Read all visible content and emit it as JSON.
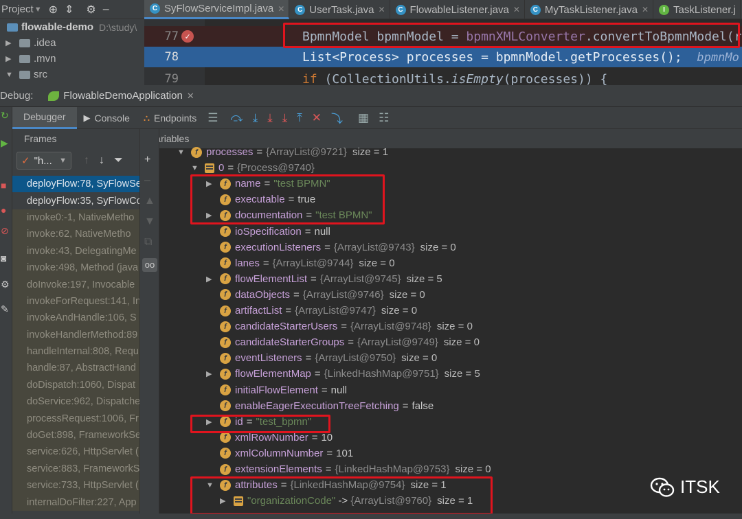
{
  "project": {
    "title": "Project",
    "tree": [
      {
        "name": "flowable-demo",
        "path": "D:\\study\\"
      },
      {
        "name": ".idea"
      },
      {
        "name": ".mvn"
      },
      {
        "name": "src"
      }
    ]
  },
  "editor": {
    "tabs": [
      {
        "label": "SyFlowServiceImpl.java",
        "active": true
      },
      {
        "label": "UserTask.java",
        "active": false
      },
      {
        "label": "FlowableListener.java",
        "active": false
      },
      {
        "label": "MyTaskListener.java",
        "active": false
      },
      {
        "label": "TaskListener.j",
        "active": false
      }
    ],
    "lines": {
      "l77": {
        "num": "77",
        "t1": "BpmnModel bpmnModel = ",
        "t2": "bpmnXMLConverter",
        "t3": ".",
        "t4": "convertToBpmnModel",
        "t5": "(r"
      },
      "l78": {
        "num": "78",
        "t1": "List<Process> processes = bpmnModel.",
        "t2": "getProcesses",
        "t3": "();",
        "hint": "bpmnMo"
      },
      "l79": {
        "num": "79",
        "t1": "if",
        "t2": " (CollectionUtils.",
        "t3": "isEmpty",
        "t4": "(processes)) {"
      }
    }
  },
  "debug": {
    "label": "Debug:",
    "config": "FlowableDemoApplication",
    "tabs": {
      "debugger": "Debugger",
      "console": "Console",
      "endpoints": "Endpoints"
    },
    "frames_title": "Frames",
    "thread_filter": "\"h...",
    "variables_title": "Variables"
  },
  "frames": [
    {
      "text": "deployFlow:78, SyFlowSe",
      "style": "sel"
    },
    {
      "text": "deployFlow:35, SyFlowCo",
      "style": "bright"
    },
    {
      "text": "invoke0:-1, NativeMetho",
      "style": "lib"
    },
    {
      "text": "invoke:62, NativeMetho",
      "style": "lib"
    },
    {
      "text": "invoke:43, DelegatingMe",
      "style": "lib"
    },
    {
      "text": "invoke:498, Method (java",
      "style": "lib"
    },
    {
      "text": "doInvoke:197, Invocable",
      "style": "lib"
    },
    {
      "text": "invokeForRequest:141, In",
      "style": "lib"
    },
    {
      "text": "invokeAndHandle:106, S",
      "style": "lib"
    },
    {
      "text": "invokeHandlerMethod:89",
      "style": "lib"
    },
    {
      "text": "handleInternal:808, Requ",
      "style": "lib"
    },
    {
      "text": "handle:87, AbstractHand",
      "style": "lib"
    },
    {
      "text": "doDispatch:1060, Dispat",
      "style": "lib"
    },
    {
      "text": "doService:962, Dispatche",
      "style": "lib"
    },
    {
      "text": "processRequest:1006, Fr",
      "style": "lib"
    },
    {
      "text": "doGet:898, FrameworkSe",
      "style": "lib"
    },
    {
      "text": "service:626, HttpServlet (",
      "style": "lib"
    },
    {
      "text": "service:883, FrameworkS",
      "style": "lib"
    },
    {
      "text": "service:733, HttpServlet (",
      "style": "lib"
    },
    {
      "text": "internalDoFilter:227, App",
      "style": "lib"
    }
  ],
  "variables": [
    {
      "indent": 0,
      "tri": "▼",
      "icon": "f",
      "name": "processes",
      "ref": "{ArrayList@9721}",
      "size": "size = 1"
    },
    {
      "indent": 1,
      "tri": "▼",
      "icon": "list",
      "name": "0",
      "ref": "{Process@9740}"
    },
    {
      "indent": 2,
      "tri": "▶",
      "icon": "f",
      "name": "name",
      "str": "\"test BPMN\""
    },
    {
      "indent": 2,
      "tri": "",
      "icon": "f",
      "name": "executable",
      "val": "true"
    },
    {
      "indent": 2,
      "tri": "▶",
      "icon": "f",
      "name": "documentation",
      "str": "\"test BPMN\""
    },
    {
      "indent": 2,
      "tri": "",
      "icon": "f",
      "name": "ioSpecification",
      "val": "null"
    },
    {
      "indent": 2,
      "tri": "",
      "icon": "f",
      "name": "executionListeners",
      "ref": "{ArrayList@9743}",
      "size": "size = 0"
    },
    {
      "indent": 2,
      "tri": "",
      "icon": "f",
      "name": "lanes",
      "ref": "{ArrayList@9744}",
      "size": "size = 0"
    },
    {
      "indent": 2,
      "tri": "▶",
      "icon": "f",
      "name": "flowElementList",
      "ref": "{ArrayList@9745}",
      "size": "size = 5"
    },
    {
      "indent": 2,
      "tri": "",
      "icon": "f",
      "name": "dataObjects",
      "ref": "{ArrayList@9746}",
      "size": "size = 0"
    },
    {
      "indent": 2,
      "tri": "",
      "icon": "f",
      "name": "artifactList",
      "ref": "{ArrayList@9747}",
      "size": "size = 0"
    },
    {
      "indent": 2,
      "tri": "",
      "icon": "f",
      "name": "candidateStarterUsers",
      "ref": "{ArrayList@9748}",
      "size": "size = 0"
    },
    {
      "indent": 2,
      "tri": "",
      "icon": "f",
      "name": "candidateStarterGroups",
      "ref": "{ArrayList@9749}",
      "size": "size = 0"
    },
    {
      "indent": 2,
      "tri": "",
      "icon": "f",
      "name": "eventListeners",
      "ref": "{ArrayList@9750}",
      "size": "size = 0"
    },
    {
      "indent": 2,
      "tri": "▶",
      "icon": "f",
      "name": "flowElementMap",
      "ref": "{LinkedHashMap@9751}",
      "size": "size = 5"
    },
    {
      "indent": 2,
      "tri": "",
      "icon": "f",
      "name": "initialFlowElement",
      "val": "null"
    },
    {
      "indent": 2,
      "tri": "",
      "icon": "f",
      "name": "enableEagerExecutionTreeFetching",
      "val": "false"
    },
    {
      "indent": 2,
      "tri": "▶",
      "icon": "f",
      "name": "id",
      "str": "\"test_bpmn\""
    },
    {
      "indent": 2,
      "tri": "",
      "icon": "f",
      "name": "xmlRowNumber",
      "val": "10"
    },
    {
      "indent": 2,
      "tri": "",
      "icon": "f",
      "name": "xmlColumnNumber",
      "val": "101"
    },
    {
      "indent": 2,
      "tri": "",
      "icon": "f",
      "name": "extensionElements",
      "ref": "{LinkedHashMap@9753}",
      "size": "size = 0"
    },
    {
      "indent": 2,
      "tri": "▼",
      "icon": "f",
      "name": "attributes",
      "ref": "{LinkedHashMap@9754}",
      "size": "size = 1"
    },
    {
      "indent": 3,
      "tri": "▶",
      "icon": "list",
      "name": "\"organizationCode\"",
      "arrow": " -> ",
      "ref": "{ArrayList@9760}",
      "size": "size = 1",
      "nameIsStr": true
    }
  ],
  "watermark": "ITSK",
  "colors": {
    "highlight": "#e0141e",
    "selection": "#0d5689",
    "field_icon": "#d9a343"
  }
}
